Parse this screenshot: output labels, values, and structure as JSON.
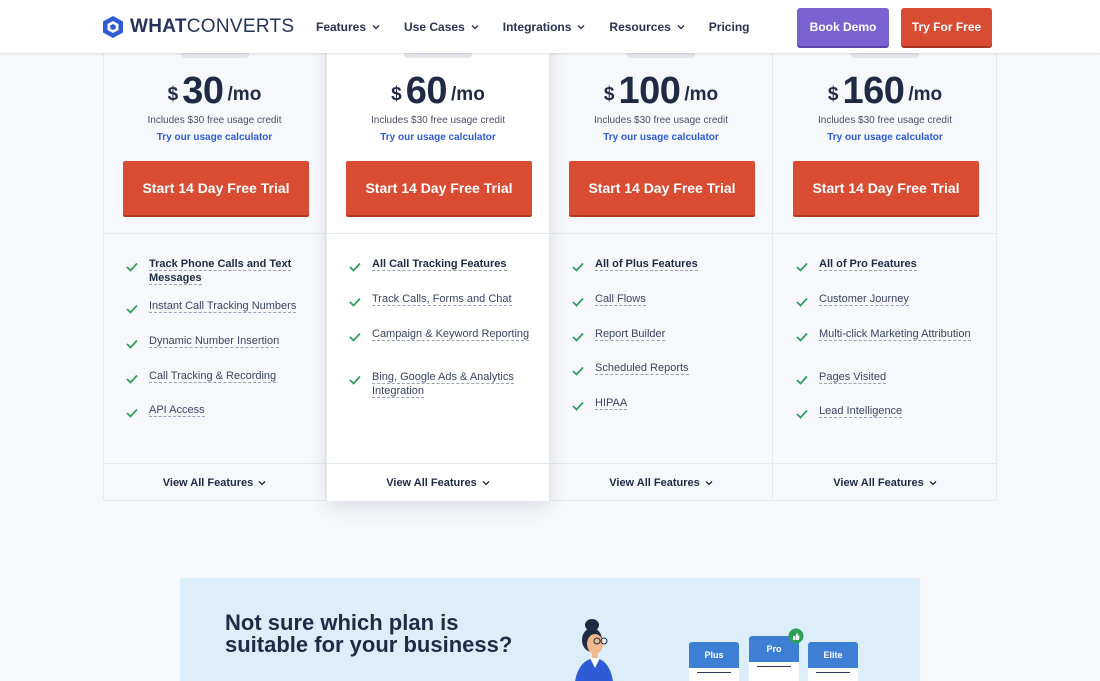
{
  "header": {
    "logo_bold": "WHAT",
    "logo_rest": "CONVERTS",
    "nav": [
      {
        "label": "Features",
        "dropdown": true
      },
      {
        "label": "Use Cases",
        "dropdown": true
      },
      {
        "label": "Integrations",
        "dropdown": true
      },
      {
        "label": "Resources",
        "dropdown": true
      },
      {
        "label": "Pricing",
        "dropdown": false
      }
    ],
    "book_demo": "Book Demo",
    "try_free": "Try For Free"
  },
  "colors": {
    "accent_red": "#d94b33",
    "accent_purple": "#7b62d1",
    "link_blue": "#2f5bd6",
    "check_green": "#2e9e5b"
  },
  "plans": [
    {
      "currency": "$",
      "amount": "30",
      "period": "/mo",
      "credit": "Includes $30 free usage credit",
      "calc": "Try our usage calculator",
      "cta": "Start 14 Day Free Trial",
      "features": [
        "Track Phone Calls and Text Messages",
        "Instant Call Tracking Numbers",
        "Dynamic Number Insertion",
        "Call Tracking & Recording",
        "API Access"
      ],
      "view_all": "View All Features"
    },
    {
      "currency": "$",
      "amount": "60",
      "period": "/mo",
      "credit": "Includes $30 free usage credit",
      "calc": "Try our usage calculator",
      "cta": "Start 14 Day Free Trial",
      "features": [
        "All Call Tracking Features",
        "Track Calls, Forms and Chat",
        "Campaign & Keyword Reporting",
        "Bing, Google Ads & Analytics Integration"
      ],
      "view_all": "View All Features"
    },
    {
      "currency": "$",
      "amount": "100",
      "period": "/mo",
      "credit": "Includes $30 free usage credit",
      "calc": "Try our usage calculator",
      "cta": "Start 14 Day Free Trial",
      "features": [
        "All of Plus Features",
        "Call Flows",
        "Report Builder",
        "Scheduled Reports",
        "HIPAA"
      ],
      "view_all": "View All Features"
    },
    {
      "currency": "$",
      "amount": "160",
      "period": "/mo",
      "credit": "Includes $30 free usage credit",
      "calc": "Try our usage calculator",
      "cta": "Start 14 Day Free Trial",
      "features": [
        "All of Pro Features",
        "Customer Journey",
        "Multi-click Marketing Attribution",
        "Pages Visited",
        "Lead Intelligence"
      ],
      "view_all": "View All Features"
    }
  ],
  "banner": {
    "title": "Not sure which plan is suitable for your business?",
    "cards": [
      "Plus",
      "Pro",
      "Elite"
    ]
  }
}
